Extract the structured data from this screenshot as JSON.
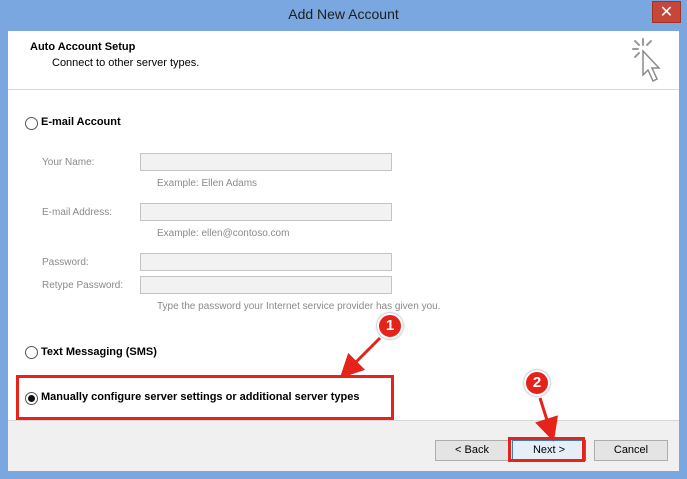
{
  "window": {
    "title": "Add New Account",
    "close_glyph": "✕"
  },
  "header": {
    "title": "Auto Account Setup",
    "subtitle": "Connect to other server types."
  },
  "options": {
    "email": {
      "label": "E-mail Account",
      "selected": false
    },
    "sms": {
      "label": "Text Messaging (SMS)",
      "selected": false
    },
    "manual": {
      "label": "Manually configure server settings or additional server types",
      "selected": true
    }
  },
  "form": {
    "name_label": "Your Name:",
    "name_hint": "Example: Ellen Adams",
    "email_label": "E-mail Address:",
    "email_hint": "Example: ellen@contoso.com",
    "password_label": "Password:",
    "retype_label": "Retype Password:",
    "password_hint": "Type the password your Internet service provider has given you."
  },
  "buttons": {
    "back": "< Back",
    "next": "Next >",
    "cancel": "Cancel"
  },
  "annotations": {
    "badge1": "1",
    "badge2": "2",
    "color": "#e5231b"
  },
  "icons": {
    "header": "sparkle-cursor-icon",
    "close": "close-icon"
  }
}
